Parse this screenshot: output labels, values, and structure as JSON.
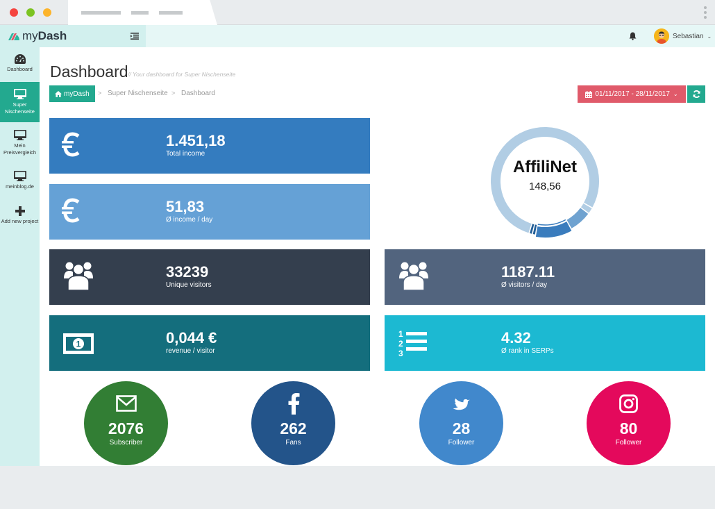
{
  "browser": {
    "window_controls": [
      "close",
      "minimize",
      "maximize"
    ]
  },
  "topbar": {
    "brand_prefix": "my",
    "brand_bold": "Dash",
    "user_name": "Sebastian",
    "user_caret": "⌄",
    "icons": [
      "menu-toggle-icon",
      "bell-icon",
      "avatar"
    ]
  },
  "sidebar": {
    "items": [
      {
        "label": "Dashboard",
        "icon": "dashboard-gauge-icon",
        "active": false
      },
      {
        "label": "Super Nischenseite",
        "icon": "monitor-icon",
        "active": true
      },
      {
        "label": "Mein Preisvergleich",
        "icon": "monitor-icon",
        "active": false
      },
      {
        "label": "meinblog.de",
        "icon": "monitor-icon",
        "active": false
      },
      {
        "label": "Add new project",
        "icon": "plus-icon",
        "active": false
      }
    ]
  },
  "header": {
    "title": "Dashboard",
    "subtitle": "// Your dashboard for Super Nischenseite",
    "breadcrumb": [
      "myDash",
      "Super Nischenseite",
      "Dashboard"
    ],
    "breadcrumb_sep": ">",
    "date_range": "01/11/2017 - 28/11/2017",
    "date_caret": "⌄"
  },
  "stats": [
    {
      "value": "1.451,18",
      "label": "Total income",
      "icon": "euro-icon",
      "color": "#347cbf"
    },
    {
      "value": "51,83",
      "label": "Ø income / day",
      "icon": "euro-icon",
      "color": "#65a1d6"
    },
    {
      "value": "33239",
      "label": "Unique visitors",
      "icon": "users-icon",
      "color": "#343f4e"
    },
    {
      "value": "0,044 €",
      "label": "revenue / visitor",
      "icon": "money-bill-icon",
      "color": "#146e7d"
    },
    {
      "value": "1187.11",
      "label": "Ø visitors / day",
      "icon": "users-icon",
      "color": "#52647e"
    },
    {
      "value": "4.32",
      "label": "Ø rank in SERPs",
      "icon": "ordered-list-icon",
      "color": "#1cb9d2"
    }
  ],
  "donut": {
    "title": "AffiliNet",
    "value": "148,56"
  },
  "chart_data": {
    "type": "pie",
    "title": "AffiliNet",
    "center_label": "148,56",
    "highlighted": "AffiliNet",
    "segments": [
      {
        "name": "segment-1",
        "share": 0.8,
        "color": "#b1cde4"
      },
      {
        "name": "segment-2",
        "share": 0.02,
        "color": "#b1cde4"
      },
      {
        "name": "segment-3",
        "share": 0.07,
        "color": "#6fa2d0"
      },
      {
        "name": "AffiliNet",
        "share": 0.11,
        "color": "#3a7cbd"
      },
      {
        "name": "segment-5",
        "share": 0.01,
        "color": "#235f98"
      },
      {
        "name": "segment-6",
        "share": 0.01,
        "color": "#235f98"
      }
    ]
  },
  "social": [
    {
      "value": "2076",
      "label": "Subscriber",
      "icon": "envelope-icon",
      "color": "#327e34"
    },
    {
      "value": "262",
      "label": "Fans",
      "icon": "facebook-icon",
      "color": "#23548a"
    },
    {
      "value": "28",
      "label": "Follower",
      "icon": "twitter-icon",
      "color": "#4188cc"
    },
    {
      "value": "80",
      "label": "Follower",
      "icon": "instagram-icon",
      "color": "#e4095c"
    }
  ],
  "chat": {
    "icon": "chat-bubbles-icon"
  }
}
